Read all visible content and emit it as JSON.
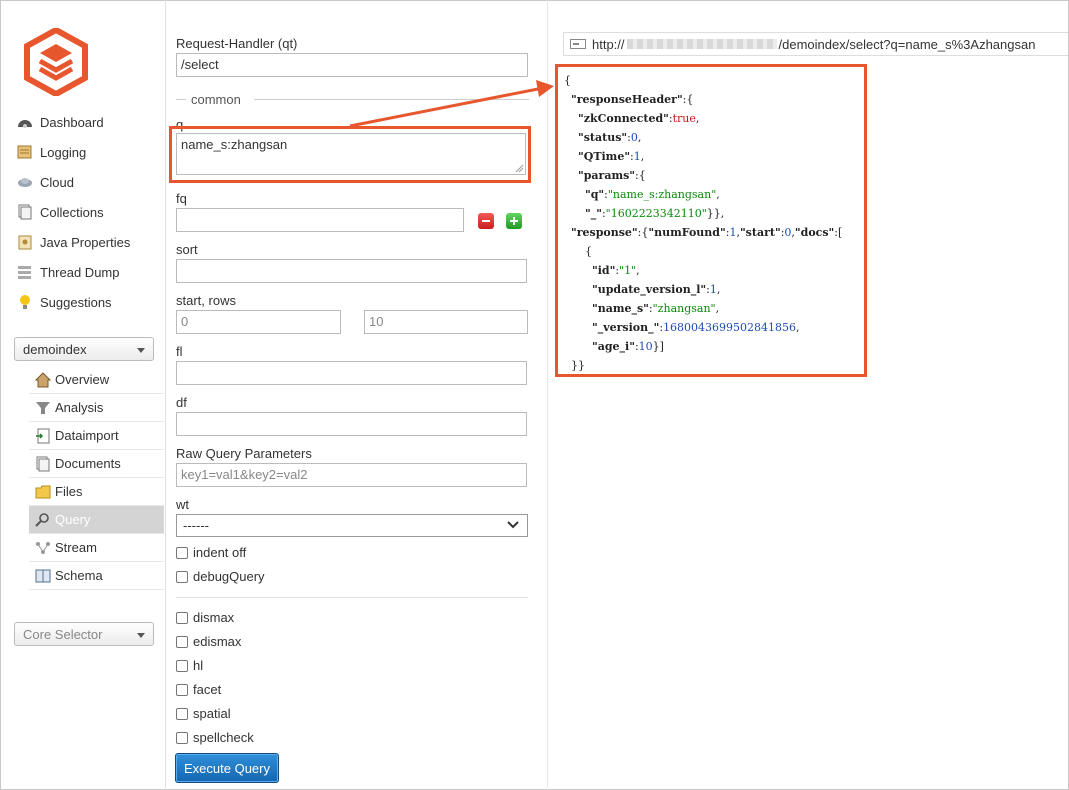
{
  "sidebar": {
    "nav": [
      {
        "label": "Dashboard",
        "icon": "dashboard-icon"
      },
      {
        "label": "Logging",
        "icon": "logging-icon"
      },
      {
        "label": "Cloud",
        "icon": "cloud-icon"
      },
      {
        "label": "Collections",
        "icon": "collections-icon"
      },
      {
        "label": "Java Properties",
        "icon": "java-properties-icon"
      },
      {
        "label": "Thread Dump",
        "icon": "thread-dump-icon"
      },
      {
        "label": "Suggestions",
        "icon": "suggestions-icon"
      }
    ],
    "core_select": "demoindex",
    "core_nav": [
      {
        "label": "Overview",
        "icon": "home-icon"
      },
      {
        "label": "Analysis",
        "icon": "funnel-icon"
      },
      {
        "label": "Dataimport",
        "icon": "dataimport-icon"
      },
      {
        "label": "Documents",
        "icon": "documents-icon"
      },
      {
        "label": "Files",
        "icon": "folder-icon"
      },
      {
        "label": "Query",
        "icon": "search-icon"
      },
      {
        "label": "Stream",
        "icon": "stream-icon"
      },
      {
        "label": "Schema",
        "icon": "schema-icon"
      }
    ],
    "active_core_item": "Query",
    "core_selector_placeholder": "Core Selector",
    "colors": {
      "active_bg": "#d4d4d4",
      "logo": "#e8562e"
    }
  },
  "form": {
    "request_handler_label": "Request-Handler (qt)",
    "request_handler_value": "/select",
    "common_legend": "common",
    "q_label": "q",
    "q_value": "name_s:zhangsan",
    "fq_label": "fq",
    "fq_value": "",
    "sort_label": "sort",
    "sort_value": "",
    "start_rows_label": "start, rows",
    "start_placeholder": "0",
    "rows_placeholder": "10",
    "fl_label": "fl",
    "fl_value": "",
    "df_label": "df",
    "df_value": "",
    "raw_label": "Raw Query Parameters",
    "raw_placeholder": "key1=val1&key2=val2",
    "wt_label": "wt",
    "wt_value": "------",
    "checkboxes_top": [
      "indent off",
      "debugQuery"
    ],
    "checkboxes_bottom": [
      "dismax",
      "edismax",
      "hl",
      "facet",
      "spatial",
      "spellcheck"
    ],
    "execute_label": "Execute Query",
    "colors": {
      "button": "#1a73c4",
      "highlight": "#e8562e",
      "remove": "#d32f2f",
      "add": "#2eaa2e"
    }
  },
  "response": {
    "url_prefix": "http://",
    "url_suffix": "/demoindex/select?q=name_s%3Azhangsan",
    "lines": {
      "l0": "{",
      "l1_key": "\"responseHeader\"",
      "l1_tail": ":{",
      "l2_key": "\"zkConnected\"",
      "l2_val": "true",
      "l3_key": "\"status\"",
      "l3_val": "0",
      "l4_key": "\"QTime\"",
      "l4_val": "1",
      "l5_key": "\"params\"",
      "l5_tail": ":{",
      "l6_key": "\"q\"",
      "l6_val": "\"name_s:zhangsan\"",
      "l7_key": "\"_\"",
      "l7_val": "\"1602223342110\"",
      "l7_tail": "}},",
      "l8_key": "\"response\"",
      "l8_k2": "\"numFound\"",
      "l8_v2": "1",
      "l8_k3": "\"start\"",
      "l8_v3": "0",
      "l8_k4": "\"docs\"",
      "l8_tail": ":[",
      "l9": "{",
      "l10_key": "\"id\"",
      "l10_val": "\"1\"",
      "l11_key": "\"update_version_l\"",
      "l11_val": "1",
      "l12_key": "\"name_s\"",
      "l12_val": "\"zhangsan\"",
      "l13_key": "\"_version_\"",
      "l13_val": "1680043699502841856",
      "l14_key": "\"age_i\"",
      "l14_val": "10",
      "l14_tail": "}]",
      "l15": "}}"
    },
    "colors": {
      "string": "#0a8a0a",
      "number": "#1c4bb8",
      "boolean": "#c41a16"
    }
  }
}
